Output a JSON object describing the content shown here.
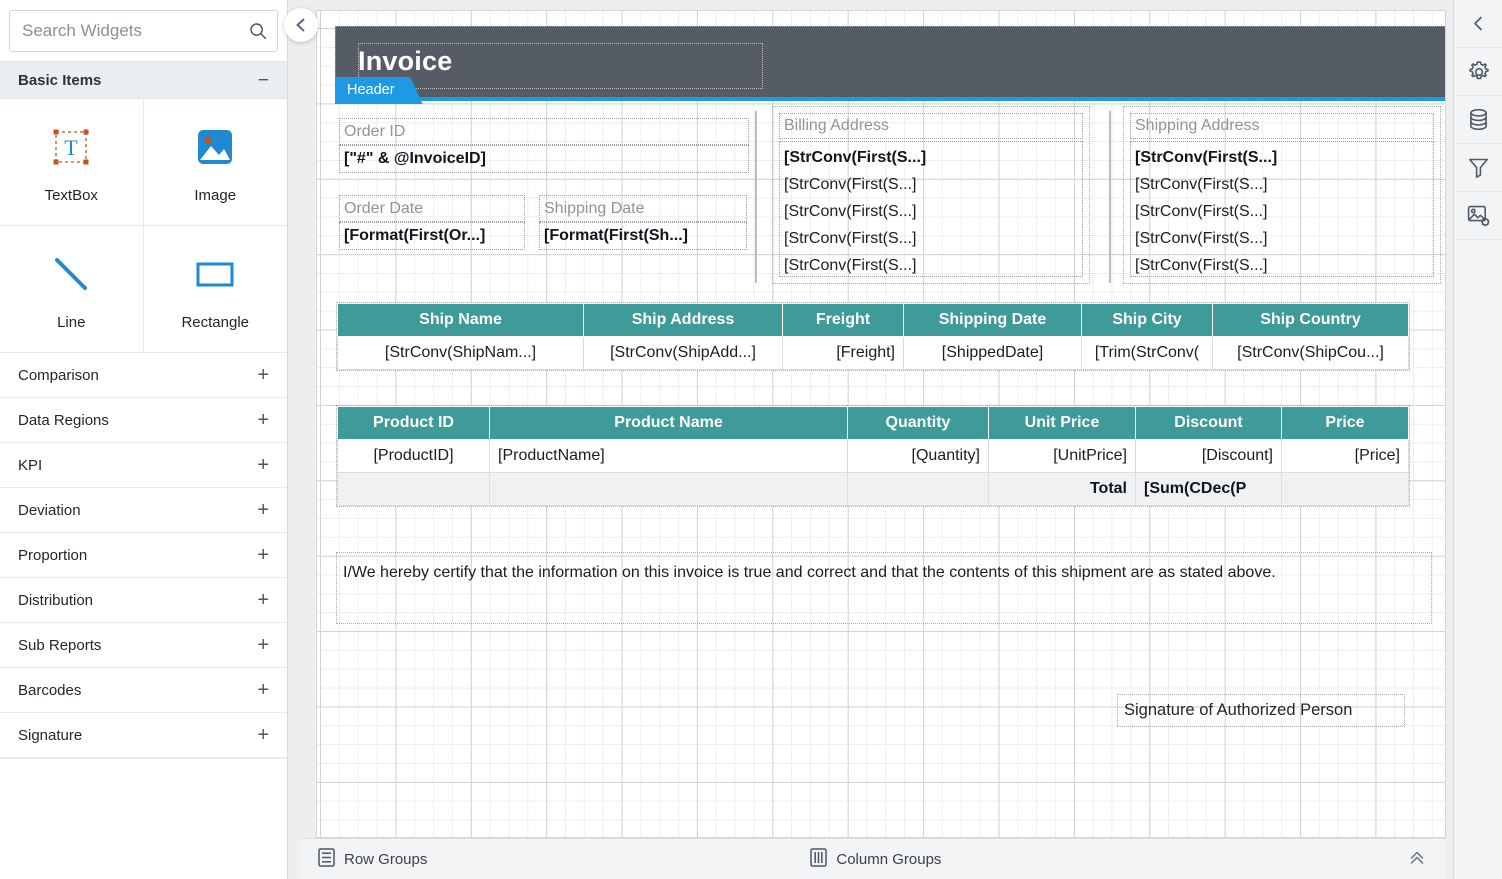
{
  "search": {
    "placeholder": "Search Widgets",
    "value": ""
  },
  "palette": {
    "group_title": "Basic Items",
    "collapse_glyph": "−",
    "widgets": [
      {
        "label": "TextBox",
        "icon": "textbox-icon"
      },
      {
        "label": "Image",
        "icon": "image-icon"
      },
      {
        "label": "Line",
        "icon": "line-icon"
      },
      {
        "label": "Rectangle",
        "icon": "rectangle-icon"
      }
    ],
    "categories": [
      {
        "label": "Comparison",
        "expand_glyph": "+"
      },
      {
        "label": "Data Regions",
        "expand_glyph": "+"
      },
      {
        "label": "KPI",
        "expand_glyph": "+"
      },
      {
        "label": "Deviation",
        "expand_glyph": "+"
      },
      {
        "label": "Proportion",
        "expand_glyph": "+"
      },
      {
        "label": "Distribution",
        "expand_glyph": "+"
      },
      {
        "label": "Sub Reports",
        "expand_glyph": "+"
      },
      {
        "label": "Barcodes",
        "expand_glyph": "+"
      },
      {
        "label": "Signature",
        "expand_glyph": "+"
      }
    ]
  },
  "report": {
    "header_band": {
      "title": "Invoice",
      "band_label": "Header"
    },
    "fields": {
      "order_id_label": "Order ID",
      "order_id_value": "[\"#\" & @InvoiceID]",
      "order_date_label": "Order Date",
      "order_date_value": "[Format(First(Or...]",
      "shipping_date_label": "Shipping Date",
      "shipping_date_value": "[Format(First(Sh...]"
    },
    "billing_address": {
      "label": "Billing Address",
      "lines": [
        "[StrConv(First(S...]",
        "[StrConv(First(S...]",
        "[StrConv(First(S...]",
        "[StrConv(First(S...]",
        "[StrConv(First(S...]"
      ]
    },
    "shipping_address": {
      "label": "Shipping Address",
      "lines": [
        "[StrConv(First(S...]",
        "[StrConv(First(S...]",
        "[StrConv(First(S...]",
        "[StrConv(First(S...]",
        "[StrConv(First(S...]"
      ]
    },
    "ship_table": {
      "headers": [
        "Ship Name",
        "Ship Address",
        "Freight",
        "Shipping Date",
        "Ship City",
        "Ship Country"
      ],
      "row": [
        "[StrConv(ShipNam...]",
        "[StrConv(ShipAdd...]",
        "[Freight]",
        "[ShippedDate]",
        "[Trim(StrConv(",
        "[StrConv(ShipCou...]"
      ]
    },
    "product_table": {
      "headers": [
        "Product ID",
        "Product Name",
        "Quantity",
        "Unit Price",
        "Discount",
        "Price"
      ],
      "row": [
        "[ProductID]",
        "[ProductName]",
        "[Quantity]",
        "[UnitPrice]",
        "[Discount]",
        "[Price]"
      ],
      "total_label": "Total",
      "total_value": "[Sum(CDec(P"
    },
    "certification_note": "I/We hereby certify that the information on this invoice is true and correct and that the contents of this shipment are as stated above.",
    "signature_label": "Signature of Authorized Person"
  },
  "bottom_bar": {
    "row_groups": "Row Groups",
    "column_groups": "Column Groups",
    "collapse_icon": "chevron-double-up-icon"
  },
  "right_toolbar": {
    "items": [
      {
        "name": "collapse-panel-icon",
        "title": "Collapse"
      },
      {
        "name": "gear-icon",
        "title": "Properties"
      },
      {
        "name": "database-icon",
        "title": "Data"
      },
      {
        "name": "filter-icon",
        "title": "Filter"
      },
      {
        "name": "image-settings-icon",
        "title": "Image Settings"
      }
    ]
  },
  "colors": {
    "accent_blue": "#1e9ae5",
    "table_header_teal": "#3f9a9a",
    "band_dark": "#555c66",
    "canvas_bg": "#eceef0"
  }
}
